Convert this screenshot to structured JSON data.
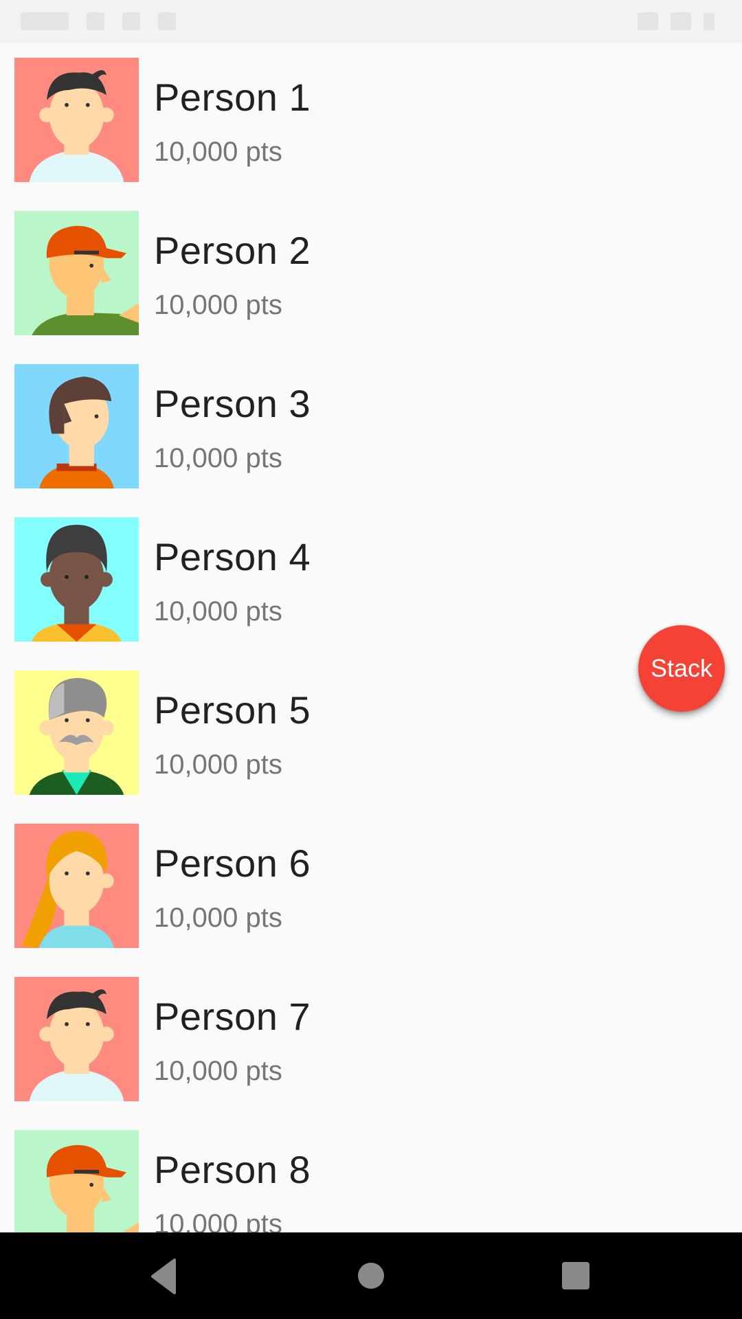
{
  "list": {
    "items": [
      {
        "name": "Person 1",
        "points": "10,000 pts",
        "avatar_icon": "person-dark-hair-icon",
        "bg": "#ff8a80"
      },
      {
        "name": "Person 2",
        "points": "10,000 pts",
        "avatar_icon": "person-orange-cap-icon",
        "bg": "#b9f6ca"
      },
      {
        "name": "Person 3",
        "points": "10,000 pts",
        "avatar_icon": "person-brown-hair-icon",
        "bg": "#80d8ff"
      },
      {
        "name": "Person 4",
        "points": "10,000 pts",
        "avatar_icon": "person-dark-skin-icon",
        "bg": "#84ffff"
      },
      {
        "name": "Person 5",
        "points": "10,000 pts",
        "avatar_icon": "person-gray-hair-mustache-icon",
        "bg": "#ffff8d"
      },
      {
        "name": "Person 6",
        "points": "10,000 pts",
        "avatar_icon": "person-blonde-hair-icon",
        "bg": "#ff8a80"
      },
      {
        "name": "Person 7",
        "points": "10,000 pts",
        "avatar_icon": "person-dark-hair-icon",
        "bg": "#ff8a80"
      },
      {
        "name": "Person 8",
        "points": "10,000 pts",
        "avatar_icon": "person-orange-cap-icon",
        "bg": "#b9f6ca"
      }
    ]
  },
  "fab": {
    "label": "Stack",
    "color": "#f44336"
  },
  "nav": {
    "back_icon": "back-triangle-icon",
    "home_icon": "home-circle-icon",
    "recents_icon": "recents-square-icon"
  }
}
